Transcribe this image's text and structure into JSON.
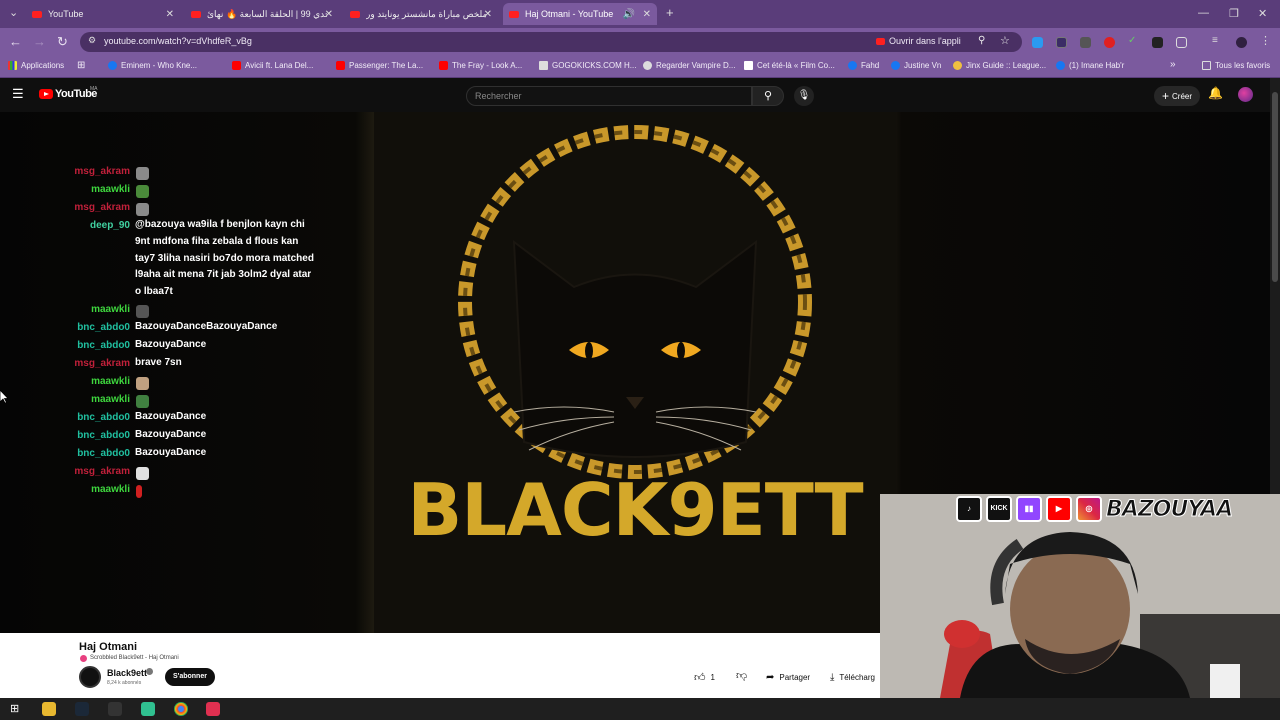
{
  "browser": {
    "tabs": [
      {
        "title": "YouTube",
        "active": false
      },
      {
        "title": "تحدي 99 | الحلقة السابعة 🔥 نهائ...",
        "active": false
      },
      {
        "title": "ملخص مباراة مانشستر يونايتد ور...",
        "active": false
      },
      {
        "title": "Haj Otmani - YouTube",
        "active": true
      }
    ],
    "url": "youtube.com/watch?v=dVhdfeR_vBg",
    "open_in_app": "Ouvrir dans l'appli",
    "bookmarks": [
      {
        "label": "Applications",
        "icon": "apps-grid-icon",
        "color": "#ffffff"
      },
      {
        "label": "Eminem - Who Kne...",
        "icon": "facebook-icon",
        "color": "#1877f2"
      },
      {
        "label": "Avicii ft. Lana Del...",
        "icon": "youtube-icon",
        "color": "#ff0000"
      },
      {
        "label": "Passenger: The La...",
        "icon": "youtube-icon",
        "color": "#ff0000"
      },
      {
        "label": "The Fray - Look A...",
        "icon": "youtube-icon",
        "color": "#ff0000"
      },
      {
        "label": "GOGOKICKS.COM H...",
        "icon": "gogokicks-icon",
        "color": "#dddddd"
      },
      {
        "label": "Regarder Vampire D...",
        "icon": "globe-icon",
        "color": "#dddddd"
      },
      {
        "label": "Cet été-là « Film Co...",
        "icon": "film-icon",
        "color": "#ffffff"
      },
      {
        "label": "Fahd",
        "icon": "facebook-icon",
        "color": "#1877f2"
      },
      {
        "label": "Justine Vn",
        "icon": "facebook-icon",
        "color": "#1877f2"
      },
      {
        "label": "Jinx Guide :: League...",
        "icon": "jinx-icon",
        "color": "#f0c040"
      },
      {
        "label": "(1) Imane Hab'r",
        "icon": "facebook-icon",
        "color": "#1877f2"
      }
    ],
    "all_favorites": "Tous les favoris"
  },
  "youtube": {
    "logo_text": "YouTube",
    "country_code": "MA",
    "search_placeholder": "Rechercher",
    "create_label": "Créer"
  },
  "video": {
    "brand_text": "BLACK9ETT",
    "chat": [
      {
        "user": "msg_akram",
        "color": "#c0203a",
        "emote": "#8a8a8a"
      },
      {
        "user": "maawkli",
        "color": "#3ed63e",
        "emote": "#4a8a3a"
      },
      {
        "user": "msg_akram",
        "color": "#c0203a",
        "emote": "#8a8a8a"
      },
      {
        "user": "deep_90",
        "color": "#40d0a0",
        "lines": [
          "@bazouya wa9ila f benjlon kayn chi",
          "9nt mdfona fiha zebala d flous kan",
          "tay7 3liha nasiri bo7do mora matched",
          "l9aha ait mena 7it jab 3olm2 dyal atar",
          "o lbaa7t"
        ]
      },
      {
        "user": "maawkli",
        "color": "#3ed63e",
        "emote": "#555555"
      },
      {
        "user": "bnc_abdo0",
        "color": "#20c0a0",
        "text": "BazouyaDanceBazouyaDance"
      },
      {
        "user": "bnc_abdo0",
        "color": "#20c0a0",
        "text": "BazouyaDance"
      },
      {
        "user": "msg_akram",
        "color": "#c0203a",
        "text": "brave 7sn"
      },
      {
        "user": "maawkli",
        "color": "#3ed63e",
        "emote": "#c0a080"
      },
      {
        "user": "maawkli",
        "color": "#3ed63e",
        "emote": "#408040"
      },
      {
        "user": "bnc_abdo0",
        "color": "#20c0a0",
        "text": "BazouyaDance"
      },
      {
        "user": "bnc_abdo0",
        "color": "#20c0a0",
        "text": "BazouyaDance"
      },
      {
        "user": "bnc_abdo0",
        "color": "#20c0a0",
        "text": "BazouyaDance"
      },
      {
        "user": "msg_akram",
        "color": "#c0203a",
        "emote": "#e0e0e0"
      },
      {
        "user": "maawkli",
        "color": "#3ed63e",
        "emote": "#d02020"
      }
    ],
    "title": "Haj Otmani",
    "scrobbled": "Scrobbled Black9ett - Haj Otmani",
    "channel": "Black9ett",
    "subscribers": "8,24 k abonnés",
    "subscribe_label": "S'abonner",
    "likes": "1",
    "share_label": "Partager",
    "download_label": "Télécharg"
  },
  "webcam": {
    "handle": "BAZOUYAA",
    "socials": [
      "tiktok-icon",
      "kick-icon",
      "twitch-icon",
      "youtube-icon",
      "instagram-icon"
    ],
    "kick_label": "KICK"
  },
  "colors": {
    "accent_gold": "#d4a82a",
    "youtube_red": "#ff0000",
    "browser_purple": "#7b5a9e"
  }
}
